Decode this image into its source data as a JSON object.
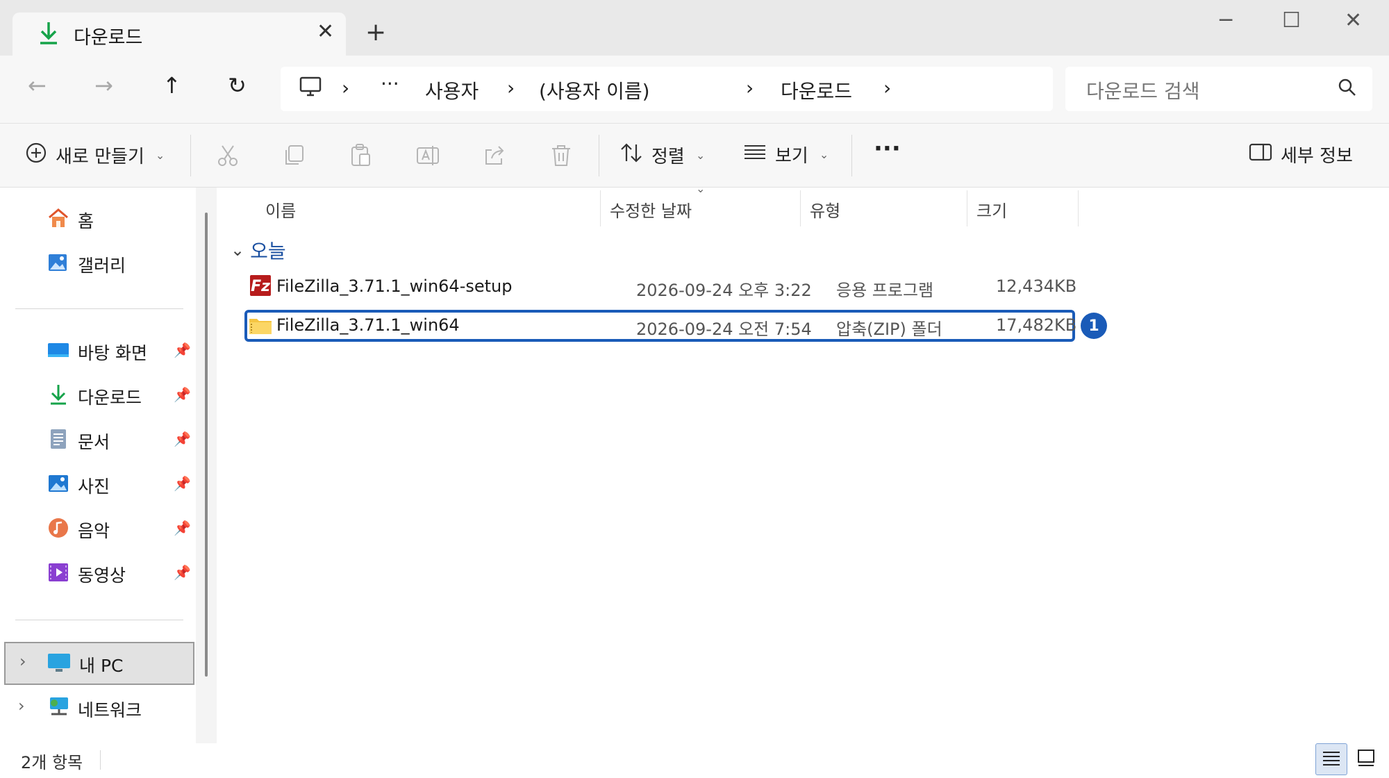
{
  "tab": {
    "title": "다운로드",
    "close": "✕",
    "new": "+"
  },
  "window": {
    "minimize": "─",
    "maximize": "☐",
    "close": "✕"
  },
  "nav": {
    "back": "←",
    "forward": "→",
    "up": "↑",
    "refresh": "↻",
    "breadcrumb": {
      "more": "···",
      "items": [
        "사용자",
        "(사용자 이름)",
        "다운로드"
      ],
      "chevron": "›"
    },
    "search_placeholder": "다운로드 검색"
  },
  "toolbar": {
    "new_label": "새로 만들기",
    "sort_label": "정렬",
    "view_label": "보기",
    "more_label": "···",
    "details_label": "세부 정보",
    "caret": "⌄"
  },
  "sidebar": {
    "home": "홈",
    "gallery": "갤러리",
    "pinned": [
      {
        "label": "바탕 화면",
        "icon": "desktop-icon"
      },
      {
        "label": "다운로드",
        "icon": "download-icon"
      },
      {
        "label": "문서",
        "icon": "document-icon"
      },
      {
        "label": "사진",
        "icon": "pictures-icon"
      },
      {
        "label": "음악",
        "icon": "music-icon"
      },
      {
        "label": "동영상",
        "icon": "video-icon"
      }
    ],
    "pin_glyph": "📌",
    "this_pc": "내 PC",
    "network": "네트워크",
    "expander": "›"
  },
  "columns": {
    "name": "이름",
    "modified": "수정한 날짜",
    "type": "유형",
    "size": "크기"
  },
  "group": {
    "label": "오늘",
    "chevron": "⌄"
  },
  "files": [
    {
      "name": "FileZilla_3.71.1_win64-setup",
      "modified": "2026-09-24 오후 3:22",
      "type": "응용 프로그램",
      "size": "12,434KB",
      "icon": "filezilla-app-icon"
    },
    {
      "name": "FileZilla_3.71.1_win64",
      "modified": "2026-09-24 오전 7:54",
      "type": "압축(ZIP) 폴더",
      "size": "17,482KB",
      "icon": "zip-folder-icon"
    }
  ],
  "annotation": {
    "badge": "1"
  },
  "status": {
    "item_count": "2개 항목"
  },
  "colors": {
    "accent": "#1a5bb8",
    "download_green": "#16a34a"
  }
}
